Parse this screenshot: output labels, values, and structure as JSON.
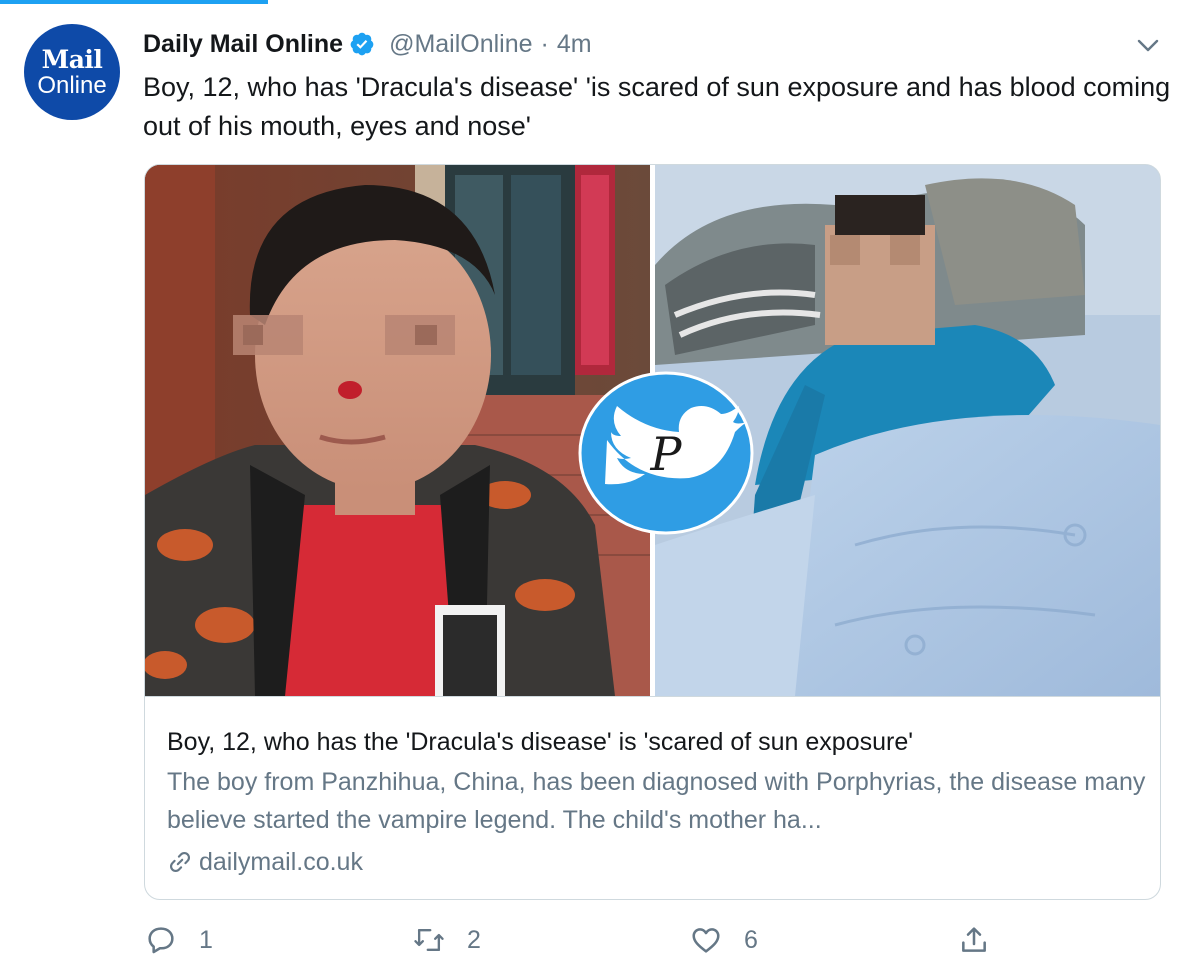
{
  "author": {
    "avatar_line1": "Mail",
    "avatar_line2": "Online",
    "name": "Daily Mail Online",
    "verified_icon": "verified-badge-icon",
    "handle": "@MailOnline",
    "separator": "·",
    "time": "4m"
  },
  "tweet": {
    "text": "Boy, 12, who has 'Dracula's disease' 'is scared of sun exposure and has blood coming out of his mouth, eyes and nose'"
  },
  "card": {
    "title": "Boy, 12, who has the 'Dracula's disease' is 'scared of sun exposure'",
    "description": "The boy from Panzhihua, China, has been diagnosed with Porphyrias, the disease many believe started the vampire legend. The child's mother ha...",
    "domain": "dailymail.co.uk",
    "link_icon": "link-icon"
  },
  "actions": {
    "reply_count": "1",
    "retweet_count": "2",
    "like_count": "6"
  },
  "colors": {
    "accent": "#1da1f2",
    "avatar_bg": "#0e4aa8",
    "secondary_text": "#657786",
    "border": "#cfd9de"
  }
}
